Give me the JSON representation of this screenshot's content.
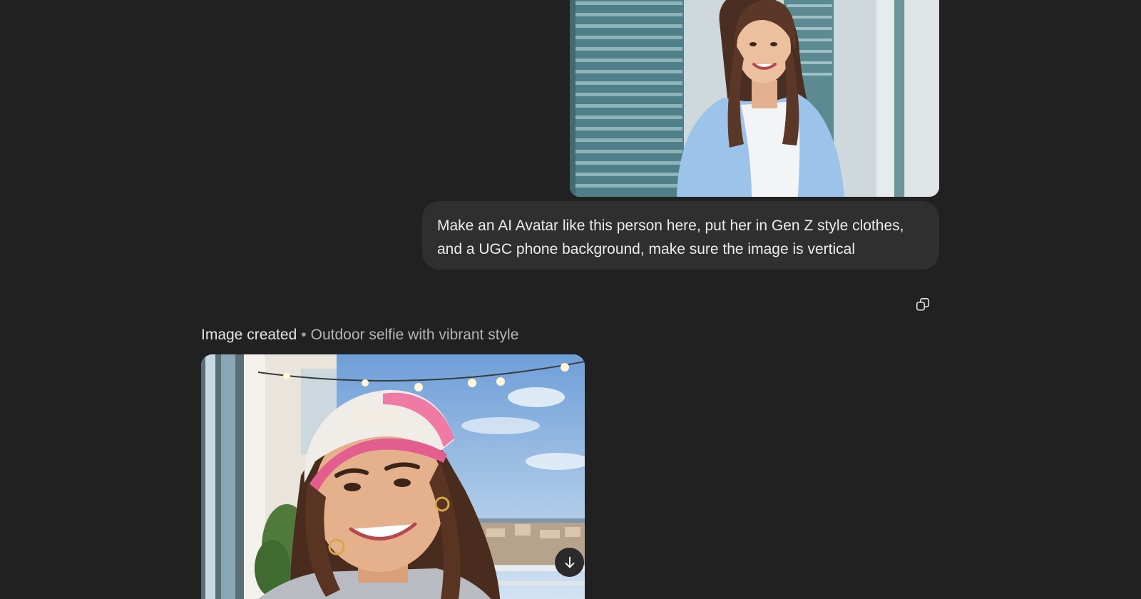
{
  "user_message": {
    "image": {
      "alt": "Reference photo of a smiling woman with long brown hair wearing a light blue shirt over a white top, standing in front of teal window shutters"
    },
    "text": "Make an AI Avatar like this person here, put her in Gen Z style clothes, and a UGC phone background, make sure the image is vertical"
  },
  "actions": {
    "copy_icon": "copy-icon"
  },
  "assistant_message": {
    "status": "Image created",
    "separator": "•",
    "caption": "Outdoor selfie with vibrant style",
    "image": {
      "alt": "Generated selfie of a smiling woman in a backwards pink and white trucker cap with hoop earrings on a sunny balcony with string lights"
    },
    "download_icon": "download-arrow-icon"
  },
  "colors": {
    "background": "#212121",
    "bubble": "#2f2f2f",
    "text": "#ececec",
    "muted_text": "#b4b4b4"
  }
}
